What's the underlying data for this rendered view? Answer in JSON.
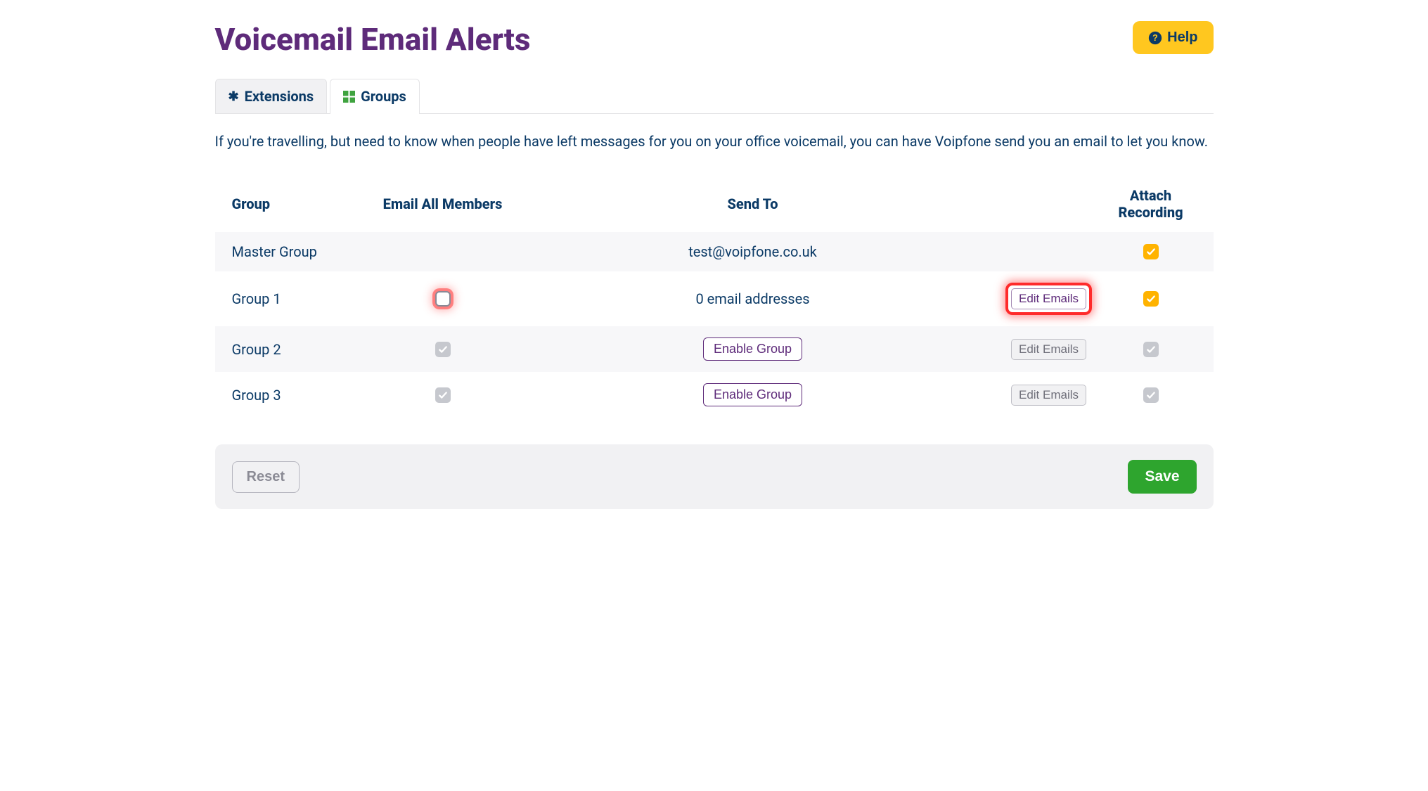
{
  "header": {
    "title": "Voicemail Email Alerts",
    "help_label": "Help"
  },
  "tabs": {
    "extensions_label": "Extensions",
    "groups_label": "Groups"
  },
  "intro": "If you're travelling, but need to know when people have left messages for you on your office voicemail, you can have Voipfone send you an email to let you know.",
  "table": {
    "headers": {
      "group": "Group",
      "email_all": "Email All Members",
      "send_to": "Send To",
      "attach": "Attach Recording"
    },
    "rows": [
      {
        "group": "Master Group",
        "email_all": null,
        "send_to_text": "test@voipfone.co.uk",
        "send_to_button": null,
        "edit_button": null,
        "attach_state": "checked-orange"
      },
      {
        "group": "Group 1",
        "email_all": "unchecked",
        "email_all_highlight": true,
        "send_to_text": "0 email addresses",
        "send_to_button": null,
        "edit_button": "Edit Emails",
        "edit_highlight": true,
        "attach_state": "checked-orange"
      },
      {
        "group": "Group 2",
        "email_all": "checked-gray",
        "send_to_text": null,
        "send_to_button": "Enable Group",
        "edit_button": "Edit Emails",
        "edit_disabled": true,
        "attach_state": "checked-gray"
      },
      {
        "group": "Group 3",
        "email_all": "checked-gray",
        "send_to_text": null,
        "send_to_button": "Enable Group",
        "edit_button": "Edit Emails",
        "edit_disabled": true,
        "attach_state": "checked-gray"
      }
    ]
  },
  "footer": {
    "reset_label": "Reset",
    "save_label": "Save"
  }
}
